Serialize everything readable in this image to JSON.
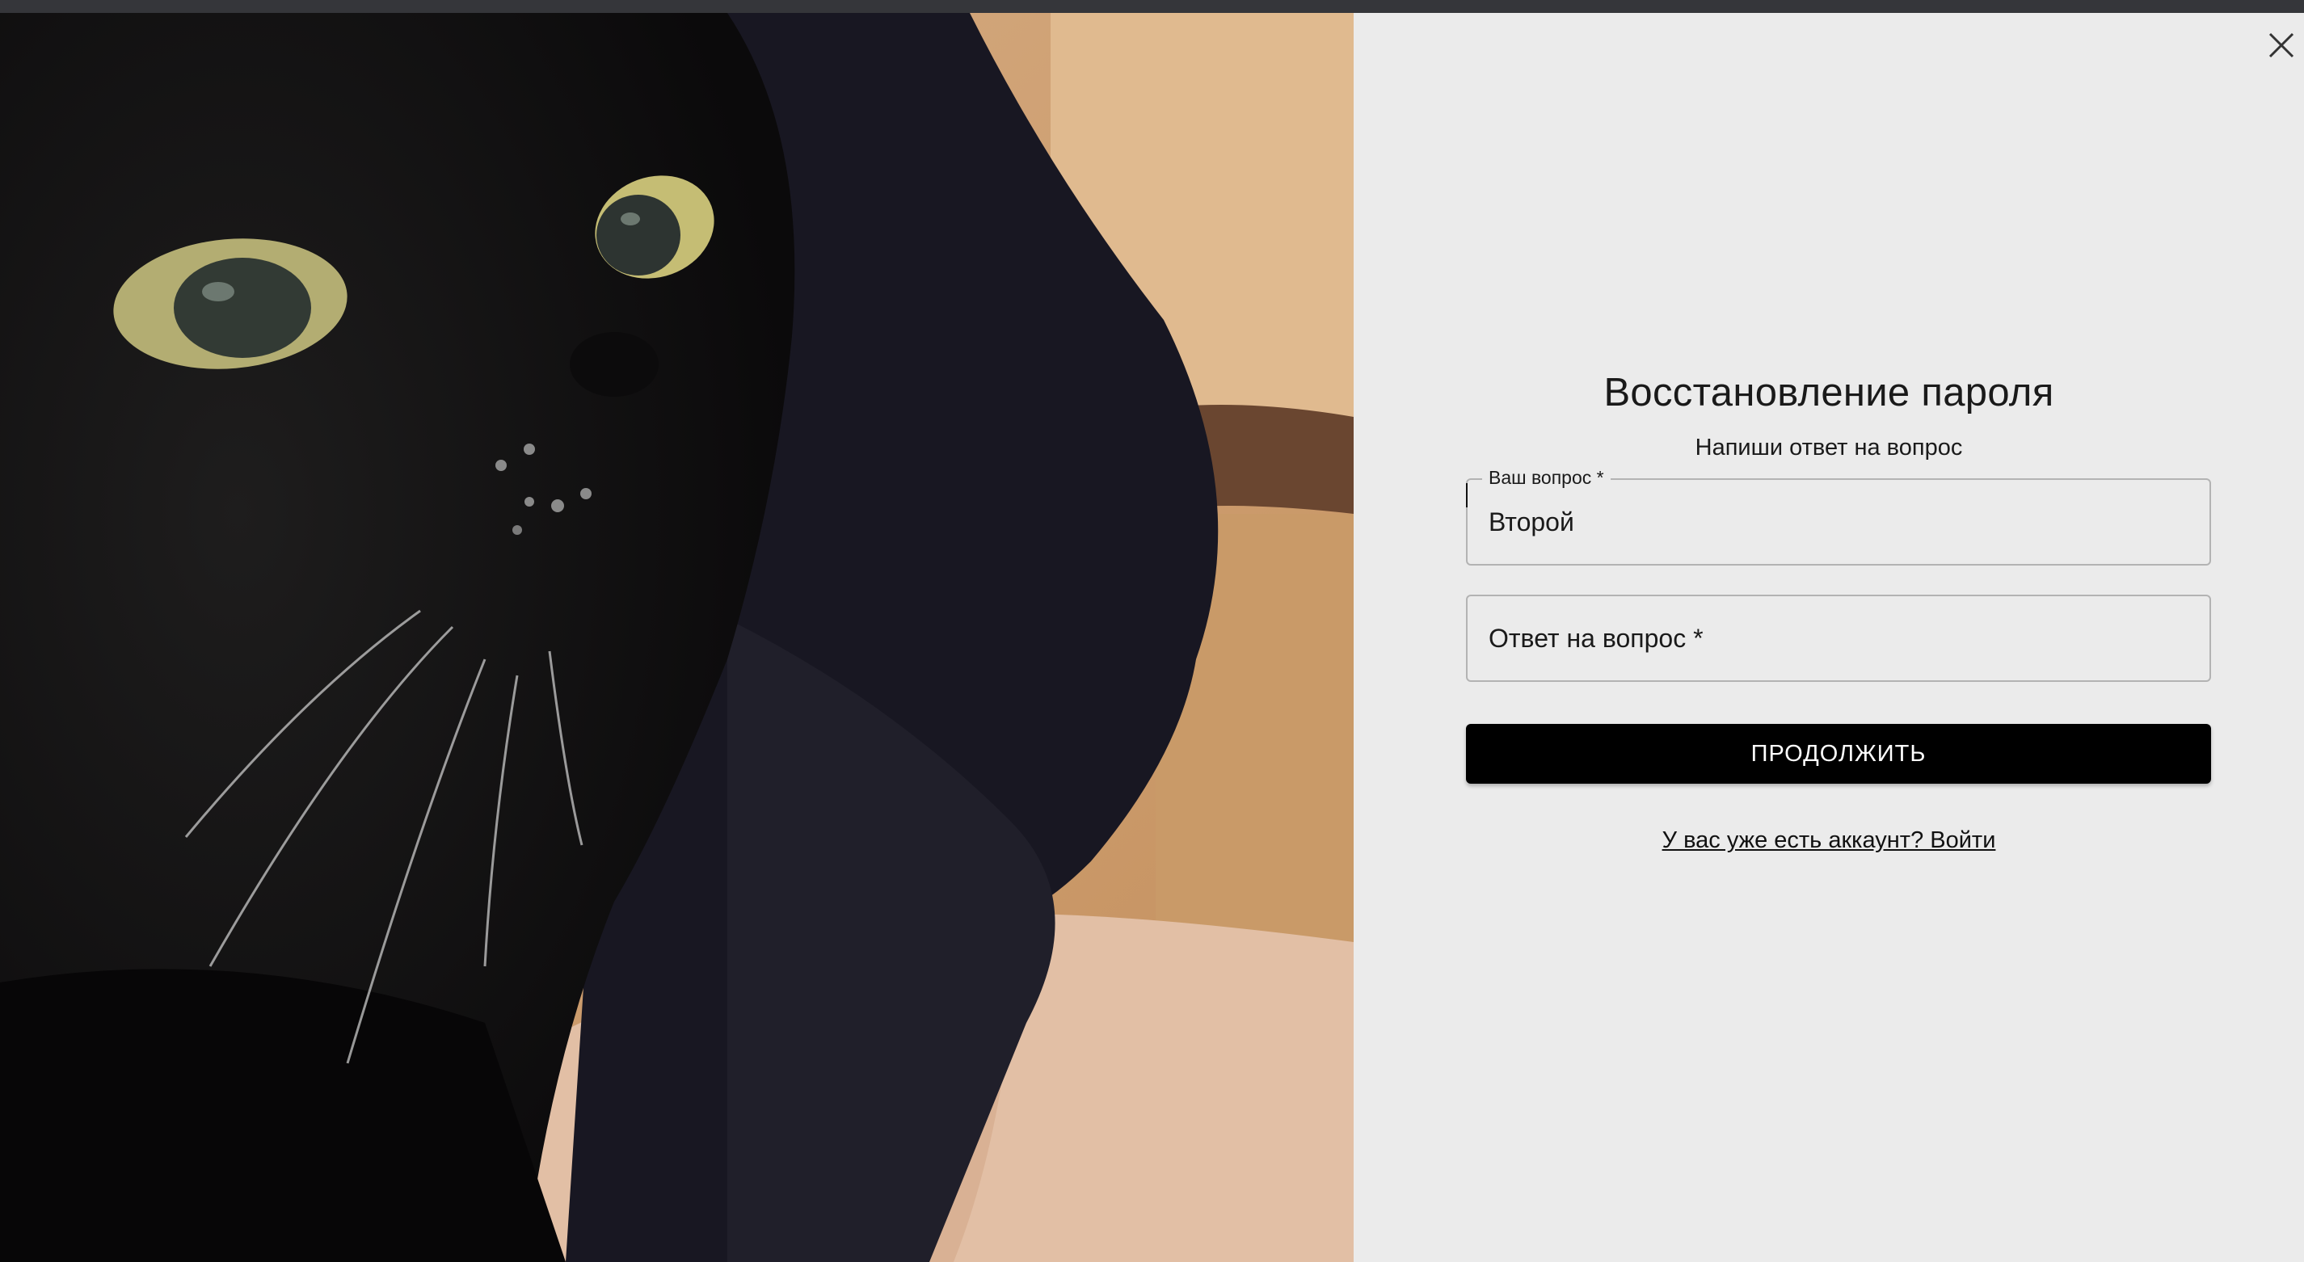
{
  "form": {
    "title": "Восстановление пароля",
    "subtitle": "Напиши ответ на вопрос",
    "question_field": {
      "legend": "Ваш вопрос *",
      "value": "Второй"
    },
    "answer_field": {
      "label": "Ответ на вопрос *"
    },
    "submit_label": "ПРОДОЛЖИТЬ",
    "login_link": "У вас уже есть аккаунт? Войти"
  },
  "icons": {
    "close": "close-icon"
  },
  "colors": {
    "panel_background": "#ebebeb",
    "button_background": "#000000",
    "button_text": "#ffffff",
    "field_border": "#b3b3b3"
  }
}
